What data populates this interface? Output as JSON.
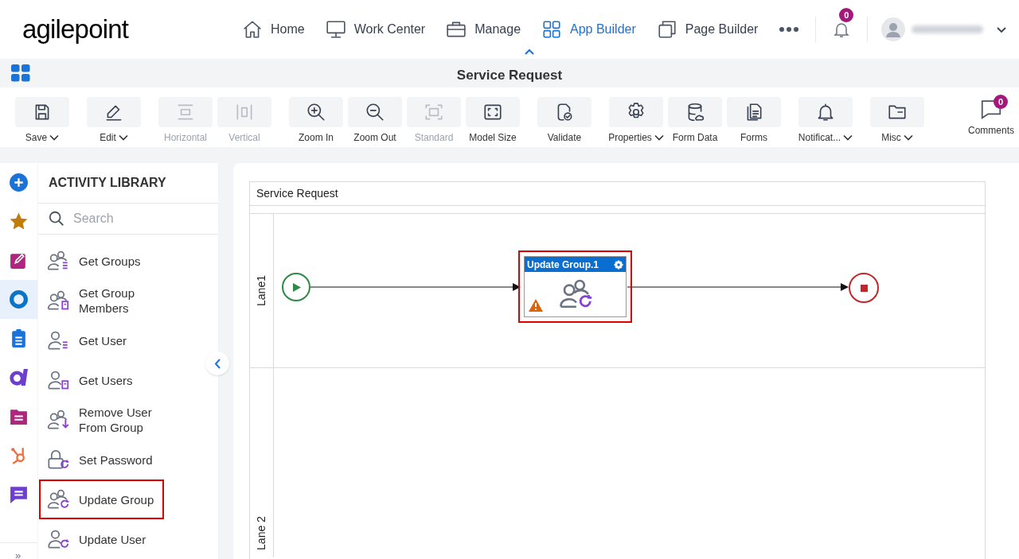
{
  "logo": "agilepoint",
  "nav": [
    {
      "label": "Home",
      "selected": false
    },
    {
      "label": "Work Center",
      "selected": false
    },
    {
      "label": "Manage",
      "selected": false
    },
    {
      "label": "App Builder",
      "selected": true
    },
    {
      "label": "Page Builder",
      "selected": false
    }
  ],
  "notifications": {
    "count": "0"
  },
  "title": "Service Request",
  "toolbar": {
    "groups": [
      [
        {
          "label": "Save",
          "dropdown": true,
          "disabled": false
        }
      ],
      [
        {
          "label": "Edit",
          "dropdown": true,
          "disabled": false
        }
      ],
      [
        {
          "label": "Horizontal",
          "dropdown": false,
          "disabled": true
        },
        {
          "label": "Vertical",
          "dropdown": false,
          "disabled": true
        }
      ],
      [
        {
          "label": "Zoom In",
          "dropdown": false,
          "disabled": false
        },
        {
          "label": "Zoom Out",
          "dropdown": false,
          "disabled": false
        },
        {
          "label": "Standard",
          "dropdown": false,
          "disabled": true
        },
        {
          "label": "Model Size",
          "dropdown": false,
          "disabled": false
        }
      ],
      [
        {
          "label": "Validate",
          "dropdown": false,
          "disabled": false
        }
      ],
      [
        {
          "label": "Properties",
          "dropdown": true,
          "disabled": false
        },
        {
          "label": "Form Data",
          "dropdown": false,
          "disabled": false
        },
        {
          "label": "Forms",
          "dropdown": false,
          "disabled": false
        }
      ],
      [
        {
          "label": "Notificat...",
          "dropdown": true,
          "disabled": false
        }
      ],
      [
        {
          "label": "Misc",
          "dropdown": true,
          "disabled": false
        }
      ]
    ]
  },
  "comments": {
    "label": "Comments",
    "count": "0"
  },
  "expand": "»",
  "rail": [
    {
      "selected": false
    },
    {
      "selected": false
    },
    {
      "selected": false
    },
    {
      "selected": true
    },
    {
      "selected": false
    },
    {
      "selected": false
    },
    {
      "selected": false
    },
    {
      "selected": false
    },
    {
      "selected": false
    }
  ],
  "library": {
    "title": "ACTIVITY LIBRARY",
    "search_placeholder": "Search",
    "items": [
      {
        "label": "Get Groups",
        "selected": false
      },
      {
        "label": "Get Group Members",
        "selected": false
      },
      {
        "label": "Get User",
        "selected": false
      },
      {
        "label": "Get Users",
        "selected": false
      },
      {
        "label": "Remove User From Group",
        "selected": false
      },
      {
        "label": "Set Password",
        "selected": false
      },
      {
        "label": "Update Group",
        "selected": true
      },
      {
        "label": "Update User",
        "selected": false
      }
    ]
  },
  "diagram": {
    "pool": "Service Request",
    "lanes": [
      {
        "label": "Lane1"
      },
      {
        "label": "Lane 2"
      }
    ],
    "task": {
      "title": "Update Group.1",
      "selected": true,
      "warning": true
    }
  }
}
